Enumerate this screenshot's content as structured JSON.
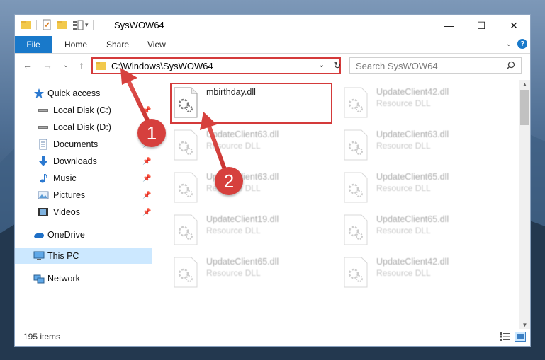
{
  "window": {
    "title": "SysWOW64",
    "controls": {
      "minimize": "—",
      "maximize": "☐",
      "close": "✕"
    }
  },
  "ribbon": {
    "tabs": [
      {
        "label": "File"
      },
      {
        "label": "Home"
      },
      {
        "label": "Share"
      },
      {
        "label": "View"
      }
    ],
    "help": "?"
  },
  "navigation": {
    "back": "←",
    "forward": "→",
    "recent": "⌄",
    "up": "↑",
    "address": "C:\\Windows\\SysWOW64",
    "refresh": "↻",
    "search_placeholder": "Search SysWOW64"
  },
  "sidebar": {
    "items": [
      {
        "label": "Quick access",
        "icon": "star-icon",
        "pinned": false
      },
      {
        "label": "Local Disk (C:)",
        "icon": "drive-icon",
        "pinned": true
      },
      {
        "label": "Local Disk (D:)",
        "icon": "drive-icon",
        "pinned": false
      },
      {
        "label": "Documents",
        "icon": "documents-icon",
        "pinned": true
      },
      {
        "label": "Downloads",
        "icon": "download-icon",
        "pinned": true
      },
      {
        "label": "Music",
        "icon": "music-icon",
        "pinned": true
      },
      {
        "label": "Pictures",
        "icon": "pictures-icon",
        "pinned": true
      },
      {
        "label": "Videos",
        "icon": "videos-icon",
        "pinned": true
      },
      {
        "label": "OneDrive",
        "icon": "cloud-icon",
        "pinned": false
      },
      {
        "label": "This PC",
        "icon": "computer-icon",
        "pinned": false,
        "selected": true
      },
      {
        "label": "Network",
        "icon": "network-icon",
        "pinned": false
      }
    ],
    "pin_glyph": "📌"
  },
  "files": [
    {
      "name": "mbirthday.dll",
      "type": ""
    },
    {
      "name": "UpdateClient42.dll",
      "type": "Resource DLL"
    },
    {
      "name": "UpdateClient63.dll",
      "type": "Resource DLL"
    },
    {
      "name": "UpdateClient63.dll",
      "type": "Resource DLL"
    },
    {
      "name": "UpdateClient63.dll",
      "type": "Resource DLL"
    },
    {
      "name": "UpdateClient65.dll",
      "type": "Resource DLL"
    },
    {
      "name": "UpdateClient19.dll",
      "type": "Resource DLL"
    },
    {
      "name": "UpdateClient65.dll",
      "type": "Resource DLL"
    },
    {
      "name": "UpdateClient65.dll",
      "type": "Resource DLL"
    },
    {
      "name": "UpdateClient42.dll",
      "type": "Resource DLL"
    }
  ],
  "status": {
    "count": "195 items"
  },
  "annotations": {
    "callout_1": "1",
    "callout_2": "2"
  },
  "colors": {
    "accent": "#1979ca",
    "highlight": "#d43a3a",
    "selected": "#cce8ff"
  }
}
